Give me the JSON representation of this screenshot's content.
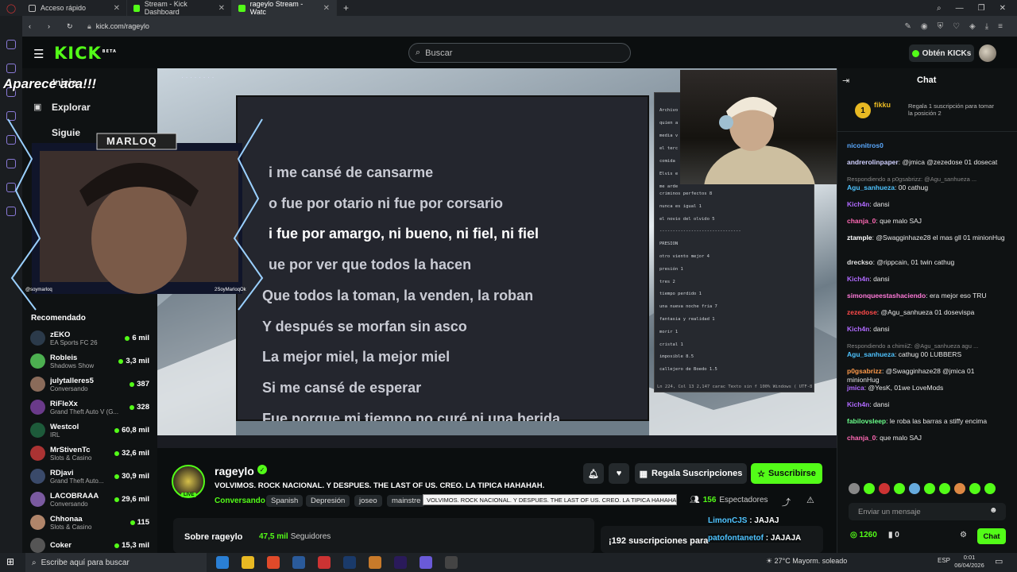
{
  "browser": {
    "tabs": [
      {
        "label": "Acceso rápido",
        "active": false
      },
      {
        "label": "Stream - Kick Dashboard",
        "active": false
      },
      {
        "label": "rageylo Stream - Watc",
        "active": true
      }
    ],
    "url": "kick.com/rageylo"
  },
  "header": {
    "logo": "KICK",
    "logo_badge": "BETA",
    "search_placeholder": "Buscar",
    "kicks_button": "Obtén KICKs"
  },
  "sidebar": {
    "nav": [
      "Inicio",
      "Explorar",
      "Siguie"
    ],
    "recommended_title": "Recomendado",
    "items": [
      {
        "name": "zEKO",
        "category": "EA Sports FC 26",
        "viewers": "6 mil",
        "color": "#2b3a4a"
      },
      {
        "name": "Robleis",
        "category": "Shadows Show",
        "viewers": "3,3 mil",
        "color": "#4caf50"
      },
      {
        "name": "julytalleres5",
        "category": "Conversando",
        "viewers": "387",
        "color": "#8a6b5a"
      },
      {
        "name": "RiFleXx",
        "category": "Grand Theft Auto V (G...",
        "viewers": "328",
        "color": "#6a3a8a"
      },
      {
        "name": "Westcol",
        "category": "IRL",
        "viewers": "60,8 mil",
        "color": "#1d5a3a"
      },
      {
        "name": "MrStivenTc",
        "category": "Slots & Casino",
        "viewers": "32,6 mil",
        "color": "#a33"
      },
      {
        "name": "RDjavi",
        "category": "Grand Theft Auto...",
        "viewers": "30,9 mil",
        "color": "#3a4a6a"
      },
      {
        "name": "LACOBRAAA",
        "category": "Conversando",
        "viewers": "29,6 mil",
        "color": "#7a5aa0"
      },
      {
        "name": "Chhonaa",
        "category": "Slots & Casino",
        "viewers": "115",
        "color": "#b0856a"
      },
      {
        "name": "Coker",
        "category": "",
        "viewers": "15,3 mil",
        "color": "#555"
      }
    ]
  },
  "overlay": {
    "caption": "Aparece aca!!!",
    "name_plate": "MARLOQ",
    "social_left": "@soymarloq",
    "social_right": "2SoyMarloqOk"
  },
  "video": {
    "lyrics": [
      "i me cansé de cansarme",
      "o fue por otario ni fue por corsario",
      "i fue por amargo, ni bueno, ni fiel, ni fiel",
      "ue por ver que todos la hacen",
      "Que todos la toman, la venden, la roban",
      "Y después se morfan sin asco",
      "La mejor miel, la mejor miel",
      "Si me cansé de esperar",
      "Fue porque mi tiempo no curé ni una herida"
    ],
    "notepad_lines": [
      "Archivo",
      "quien a",
      "media v",
      "el terc",
      "comida",
      "Elvis e",
      "me arde",
      "criminos perfectos 8",
      "nunca es igual 1",
      "el novio del olvido 5",
      "-------------------------------",
      "PRESION",
      "otro viento mejor 4",
      "presión  1",
      "tres 2",
      "tiempo perdido 1",
      "una nueva noche fria 7",
      "fantasia y realidad 1",
      "morir 1",
      "cristal 1",
      "imposible 8.5",
      "callejero de Boedo 1.5"
    ],
    "notepad_status": "Ln 224, Col 13   2,147 carac   Texto sin f   100%   Windows (   UTF-8"
  },
  "stream": {
    "streamer": "rageylo",
    "live_badge": "LIVE",
    "title": "VOLVIMOS. ROCK NACIONAL. Y DESPUES. THE LAST OF US. CREO. LA TIPICA HAHAHAH.",
    "category": "Conversando",
    "tags": [
      "Spanish",
      "Depresión",
      "joseo",
      "mainstre"
    ],
    "tooltip": "VOLVIMOS. ROCK NACIONAL. Y DESPUES. THE LAST OF US. CREO. LA TIPICA HAHAHAH.",
    "gift_button": "Regala Suscripciones",
    "subscribe_button": "Suscribirse",
    "viewers": "156",
    "viewers_label": "Espectadores",
    "about_title": "Sobre rageylo",
    "followers": "47,5 mil",
    "followers_label": "Seguidores",
    "subs_banner": "¡192 suscripciones para",
    "float_chat": [
      {
        "user": "LimonCJS",
        "text": "JAJAJ"
      },
      {
        "user": "patofontanetof",
        "text": "JAJAJA"
      }
    ]
  },
  "chat": {
    "title": "Chat",
    "pinned_user": "fikku",
    "pinned_rank": "1",
    "pinned_text": "Regala 1 suscripción para tomar la posición 2",
    "messages": [
      {
        "user": "niconitros0",
        "text": "",
        "color": "#5aa9ff",
        "reply": ""
      },
      {
        "user": "andrerolinpaper",
        "text": "@jmica @zezedose 01 dosecat",
        "color": "#d0d0ff",
        "reply": ""
      },
      {
        "user": "Agu_sanhueza",
        "text": "00 cathug",
        "color": "#4ec3ff",
        "reply": "Respondiendo a p0gsabrizz: @Agu_sanhueza ..."
      },
      {
        "user": "Kich4n",
        "text": "dansi",
        "color": "#b06aff",
        "reply": ""
      },
      {
        "user": "chanja_0",
        "text": "que malo SAJ",
        "color": "#ff69b4",
        "reply": ""
      },
      {
        "user": "ztample",
        "text": "@Swagginhaze28 el mas gll 01 minionHug",
        "color": "#ffffff",
        "reply": ""
      },
      {
        "user": "drecksо",
        "text": "@rippcain, 01 twin cathug",
        "color": "#e0e0e0",
        "reply": ""
      },
      {
        "user": "Kich4n",
        "text": "dansi",
        "color": "#b06aff",
        "reply": ""
      },
      {
        "user": "simonqueestashaciendo",
        "text": "era mejor eso TRU",
        "color": "#ff7ad9",
        "reply": ""
      },
      {
        "user": "zezedose",
        "text": "@Agu_sanhueza 01 dosevispa",
        "color": "#ff4a4a",
        "reply": ""
      },
      {
        "user": "Kich4n",
        "text": "dansi",
        "color": "#b06aff",
        "reply": ""
      },
      {
        "user": "Agu_sanhueza",
        "text": "cathug 00 LUBBERS",
        "color": "#4ec3ff",
        "reply": "Respondiendo a chimiiZ: @Agu_sanhueza agu ..."
      },
      {
        "user": "p0gsabrizz",
        "text": "@Swagginhaze28 @jmica 01 minionHug",
        "color": "#ff9a4a",
        "reply": ""
      },
      {
        "user": "jmica",
        "text": "@YesK, 01we LoveMods",
        "color": "#b06aff",
        "reply": ""
      },
      {
        "user": "Kich4n",
        "text": "dansi",
        "color": "#b06aff",
        "reply": ""
      },
      {
        "user": "fabilovsleep",
        "text": "le roba las barras a stiffy encima",
        "color": "#6aff8a",
        "reply": ""
      },
      {
        "user": "chanja_0",
        "text": "que malo SAJ",
        "color": "#ff69b4",
        "reply": ""
      }
    ],
    "input_placeholder": "Enviar un mensaje",
    "points": "1260",
    "zero": "0",
    "send_button": "Chat"
  },
  "taskbar": {
    "search_placeholder": "Escribe aquí para buscar",
    "weather": "27°C  Mayorm. soleado",
    "lang": "ESP",
    "time": "0:01",
    "date": "06/04/2026"
  },
  "colors": {
    "accent": "#53fc18",
    "background": "#0b0e0f"
  }
}
